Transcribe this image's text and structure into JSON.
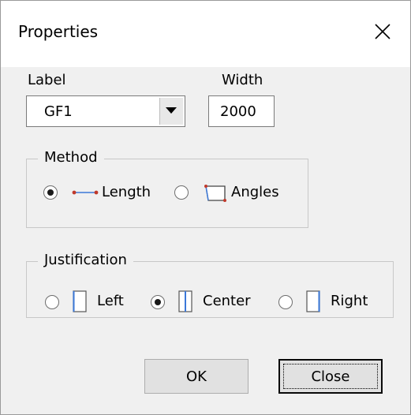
{
  "window": {
    "title": "Properties"
  },
  "label_field": {
    "caption": "Label",
    "selected": "GF1"
  },
  "width_field": {
    "caption": "Width",
    "value": "2000"
  },
  "method": {
    "title": "Method",
    "options": [
      {
        "label": "Length",
        "checked": true,
        "icon": "length-icon"
      },
      {
        "label": "Angles",
        "checked": false,
        "icon": "angles-icon"
      }
    ]
  },
  "justification": {
    "title": "Justification",
    "options": [
      {
        "label": "Left",
        "checked": false,
        "icon": "justify-left-icon"
      },
      {
        "label": "Center",
        "checked": true,
        "icon": "justify-center-icon"
      },
      {
        "label": "Right",
        "checked": false,
        "icon": "justify-right-icon"
      }
    ]
  },
  "buttons": {
    "ok": "OK",
    "close": "Close"
  },
  "colors": {
    "accent_blue": "#3b78d8",
    "accent_red": "#c0392b"
  }
}
